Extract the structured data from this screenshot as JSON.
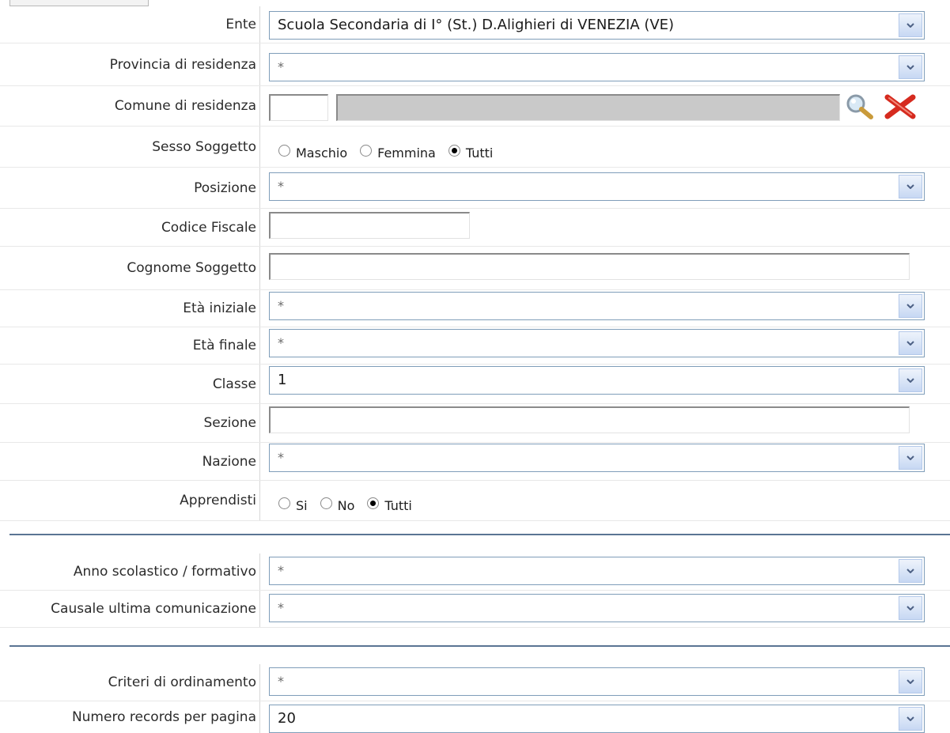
{
  "form": {
    "ente": {
      "label": "Ente",
      "value": "Scuola Secondaria di I° (St.) D.Alighieri di VENEZIA (VE)"
    },
    "provincia": {
      "label": "Provincia di residenza",
      "value": "*"
    },
    "comune": {
      "label": "Comune di residenza",
      "code": "",
      "name": ""
    },
    "sesso": {
      "label": "Sesso Soggetto",
      "options": [
        "Maschio",
        "Femmina",
        "Tutti"
      ],
      "selected": "Tutti"
    },
    "posizione": {
      "label": "Posizione",
      "value": "*"
    },
    "codice_fiscale": {
      "label": "Codice Fiscale",
      "value": ""
    },
    "cognome": {
      "label": "Cognome Soggetto",
      "value": ""
    },
    "eta_iniziale": {
      "label": "Età iniziale",
      "value": "*"
    },
    "eta_finale": {
      "label": "Età finale",
      "value": "*"
    },
    "classe": {
      "label": "Classe",
      "value": "1"
    },
    "sezione": {
      "label": "Sezione",
      "value": ""
    },
    "nazione": {
      "label": "Nazione",
      "value": "*"
    },
    "apprendisti": {
      "label": "Apprendisti",
      "options": [
        "Si",
        "No",
        "Tutti"
      ],
      "selected": "Tutti"
    },
    "anno": {
      "label": "Anno scolastico / formativo",
      "value": "*"
    },
    "causale": {
      "label": "Causale ultima comunicazione",
      "value": "*"
    },
    "criteri": {
      "label": "Criteri di ordinamento",
      "value": "*"
    },
    "numero": {
      "label": "Numero records per pagina",
      "value": "20"
    }
  },
  "icons": {
    "search": "magnifier-icon",
    "clear": "red-x-icon"
  },
  "colors": {
    "separator": "#5a7493",
    "select_border": "#7f9db9",
    "readonly_field": "#c9c9c9"
  }
}
